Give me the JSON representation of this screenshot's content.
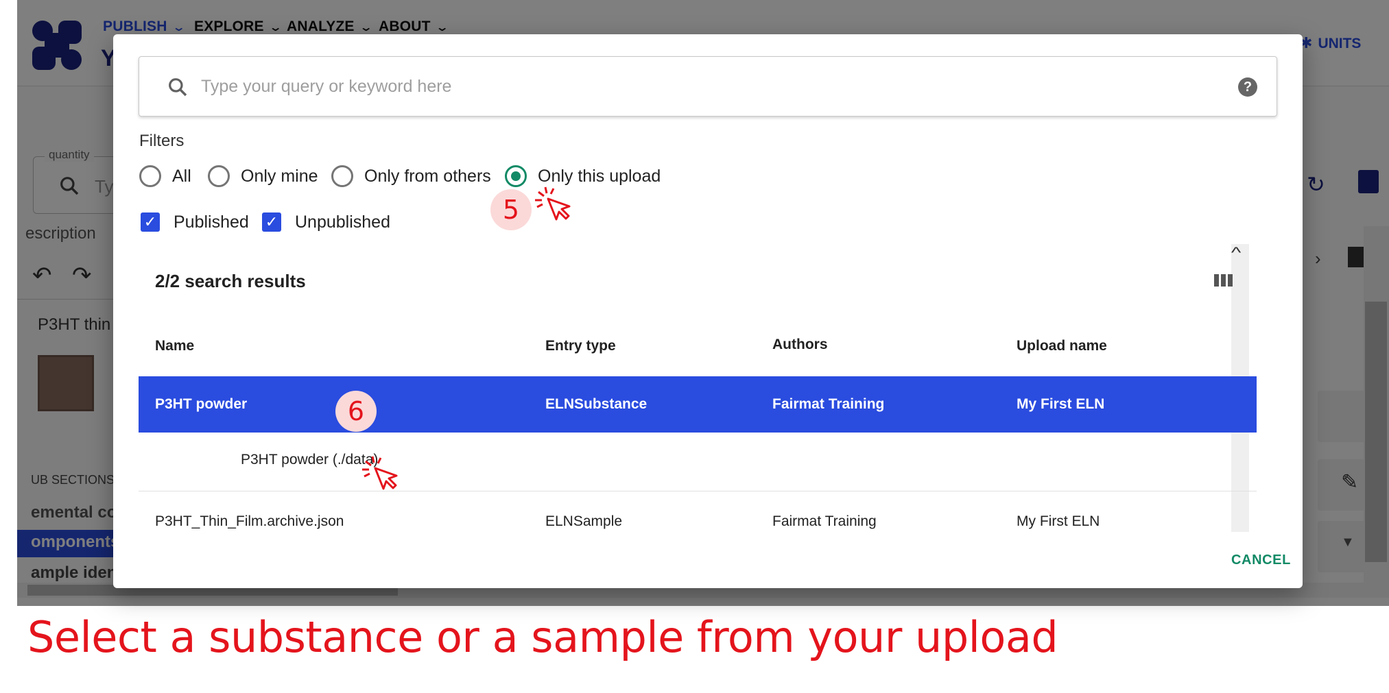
{
  "nav": {
    "items": [
      {
        "label": "PUBLISH"
      },
      {
        "label": "EXPLORE"
      },
      {
        "label": "ANALYZE"
      },
      {
        "label": "ABOUT"
      }
    ],
    "header_partial": "Y",
    "units_label": "UNITS"
  },
  "background": {
    "quantity_label": "quantity",
    "search_partial": "Ty",
    "description_partial": "escription",
    "entry_title_partial": "P3HT thin",
    "sub_sections_partial": "UB SECTIONS",
    "section_items": [
      "emental co",
      "omponents",
      "ample ident"
    ],
    "accent_color": "#2a4cdf"
  },
  "dialog": {
    "search": {
      "placeholder": "Type your query or keyword here",
      "value": ""
    },
    "filters_label": "Filters",
    "radio_options": [
      {
        "label": "All",
        "checked": false
      },
      {
        "label": "Only mine",
        "checked": false
      },
      {
        "label": "Only from others",
        "checked": false
      },
      {
        "label": "Only this upload",
        "checked": true
      }
    ],
    "checkboxes": [
      {
        "label": "Published",
        "checked": true
      },
      {
        "label": "Unpublished",
        "checked": true
      }
    ],
    "results_count": "2/2 search results",
    "columns": {
      "name": "Name",
      "entry_type": "Entry type",
      "authors": "Authors",
      "upload_name": "Upload name"
    },
    "rows": [
      {
        "name": "P3HT powder",
        "entry_type": "ELNSubstance",
        "authors": "Fairmat Training",
        "upload_name": "My First ELN",
        "selected": true
      },
      {
        "name": "P3HT_Thin_Film.archive.json",
        "entry_type": "ELNSample",
        "authors": "Fairmat Training",
        "upload_name": "My First ELN",
        "selected": false
      }
    ],
    "row_detail": "P3HT powder (./data)",
    "cancel_label": "CANCEL",
    "selected_color": "#2a4cdf",
    "radio_color": "#138a66"
  },
  "annotations": {
    "step_5": "5",
    "step_6": "6",
    "caption": "Select a substance or a sample from your upload",
    "color": "#e4141c"
  }
}
